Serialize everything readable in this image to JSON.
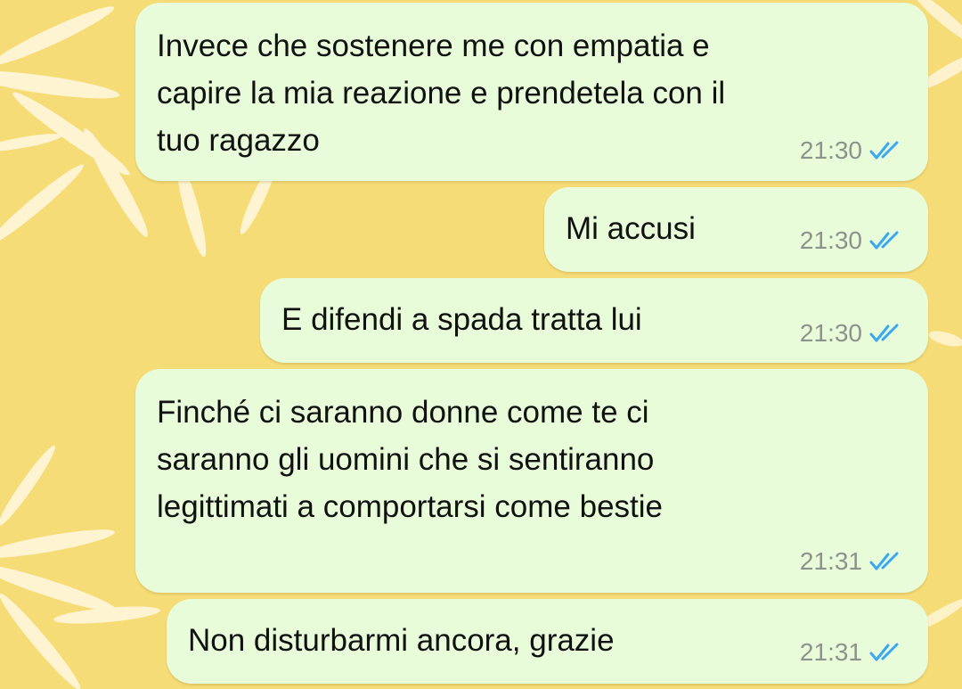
{
  "colors": {
    "wallpaper": "#f6dc76",
    "bubble": "#e8fcd9",
    "text": "#111111",
    "timestamp": "#8c938c",
    "read_ticks": "#3aa8f0"
  },
  "messages": [
    {
      "lines": [
        "Invece che sostenere me con empatia e",
        "capire la mia reazione e prendetela con il",
        "tuo ragazzo"
      ],
      "time": "21:30",
      "status_icon": "double-check-read-icon"
    },
    {
      "lines": [
        "Mi accusi"
      ],
      "time": "21:30",
      "status_icon": "double-check-read-icon"
    },
    {
      "lines": [
        "E difendi a spada tratta lui"
      ],
      "time": "21:30",
      "status_icon": "double-check-read-icon"
    },
    {
      "lines": [
        "Finché ci saranno donne come te ci",
        "saranno gli uomini che si sentiranno",
        "legittimati a comportarsi come bestie"
      ],
      "time": "21:31",
      "status_icon": "double-check-read-icon"
    },
    {
      "lines": [
        "Non disturbarmi ancora, grazie"
      ],
      "time": "21:31",
      "status_icon": "double-check-read-icon"
    }
  ]
}
